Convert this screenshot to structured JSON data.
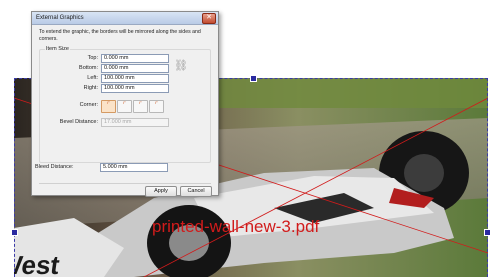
{
  "dialog": {
    "title": "External Graphics",
    "close_glyph": "✕",
    "description": "To extend the graphic, the borders will be mirrored along the sides and corners.",
    "item_size_label": "Item Size",
    "fields": {
      "top": {
        "label": "Top:",
        "value": "0.000 mm"
      },
      "bottom": {
        "label": "Bottom:",
        "value": "0.000 mm"
      },
      "left": {
        "label": "Left:",
        "value": "100.000 mm"
      },
      "right": {
        "label": "Right:",
        "value": "100.000 mm"
      }
    },
    "corner_label": "Corner:",
    "corner_icons": [
      "corner-square-icon",
      "corner-round-icon",
      "corner-bevel-icon",
      "corner-inset-icon"
    ],
    "corner_glyphs": [
      "⌜",
      "⌜",
      "⌜",
      "⌜"
    ],
    "bevel_label": "Bevel Distance:",
    "bevel_value": "17.000 mm",
    "bleed_label": "Bleed Distance:",
    "bleed_value": "5.000 mm",
    "link_icon": "link-chain-icon",
    "link_glyph": "⛓",
    "apply_label": "Apply",
    "cancel_label": "Cancel"
  },
  "canvas": {
    "file_label": "printed-wall-new-3.pdf",
    "label_color": "#d11b1b",
    "selection_color": "#2b2ba0"
  }
}
